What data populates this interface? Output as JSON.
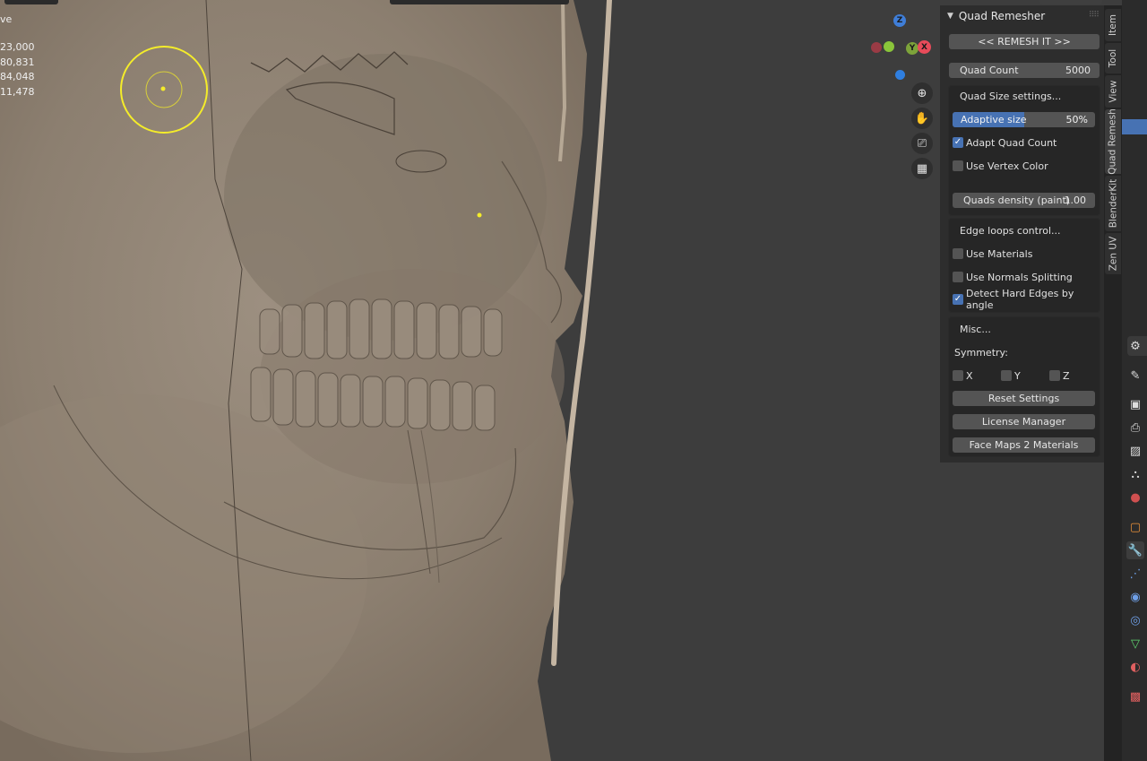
{
  "viewport": {
    "mode_text": "ve",
    "stats": [
      "23,000",
      "80,831",
      "84,048",
      "11,478"
    ]
  },
  "gizmo": {
    "z_label": "Z",
    "x_label": "X",
    "y_label": "Y",
    "colors": {
      "x": "#e84b5a",
      "y": "#8ac53a",
      "z": "#3f7ed8"
    }
  },
  "quad_remesher": {
    "title": "Quad Remesher",
    "remesh_button": "<<  REMESH IT  >>",
    "quad_count": {
      "label": "Quad Count",
      "value": "5000"
    },
    "quad_size_section": {
      "title": "Quad Size settings...",
      "adaptive_size": {
        "label": "Adaptive size",
        "value": "50%",
        "fraction": 0.5
      },
      "adapt_quad_count": {
        "label": "Adapt Quad Count",
        "checked": true
      },
      "use_vertex_color": {
        "label": "Use Vertex Color",
        "checked": false
      },
      "quads_density": {
        "label": "Quads density (paint)",
        "value": "1.00"
      }
    },
    "edge_loops_section": {
      "title": "Edge loops control...",
      "use_materials": {
        "label": "Use Materials",
        "checked": false
      },
      "use_normals_splitting": {
        "label": "Use Normals Splitting",
        "checked": false
      },
      "detect_hard_edges": {
        "label": "Detect Hard Edges by angle",
        "checked": true
      }
    },
    "misc_section": {
      "title": "Misc...",
      "symmetry_label": "Symmetry:",
      "sym_x": {
        "label": "X",
        "checked": false
      },
      "sym_y": {
        "label": "Y",
        "checked": false
      },
      "sym_z": {
        "label": "Z",
        "checked": false
      },
      "reset_settings": "Reset Settings",
      "license_manager": "License Manager",
      "face_maps_2_materials": "Face Maps 2 Materials"
    }
  },
  "sidebar_tabs": [
    "Item",
    "Tool",
    "View",
    "Quad Remesh",
    "BlenderKit",
    "Zen UV"
  ],
  "colors": {
    "accent": "#4772b3",
    "panel_bg": "#2d2d2d",
    "viewport_bg": "#3d3d3d",
    "brush_circle": "#f4ec2a"
  }
}
